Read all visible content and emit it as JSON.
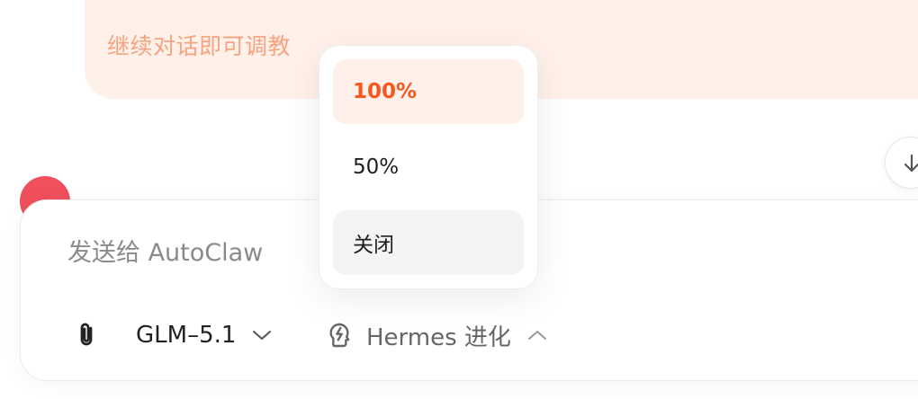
{
  "hint": {
    "text": "继续对话即可调教"
  },
  "composer": {
    "placeholder": "发送给 AutoClaw",
    "model_label": "GLM–5.1",
    "hermes_label": "Hermes 进化"
  },
  "dropdown": {
    "selected": "100%",
    "options": [
      {
        "label": "100%"
      },
      {
        "label": "50%"
      },
      {
        "label": "关闭"
      }
    ]
  },
  "icons": {
    "scroll_down": "arrow-down-icon",
    "attach": "paperclip-icon",
    "model_chevron": "chevron-down-icon",
    "hermes": "brain-bolt-icon",
    "hermes_chevron": "chevron-up-icon"
  },
  "colors": {
    "accent": "#f4581e",
    "accent_soft": "#fff0ea",
    "hint_text": "#f6a47f",
    "avatar": "#f0505c"
  }
}
